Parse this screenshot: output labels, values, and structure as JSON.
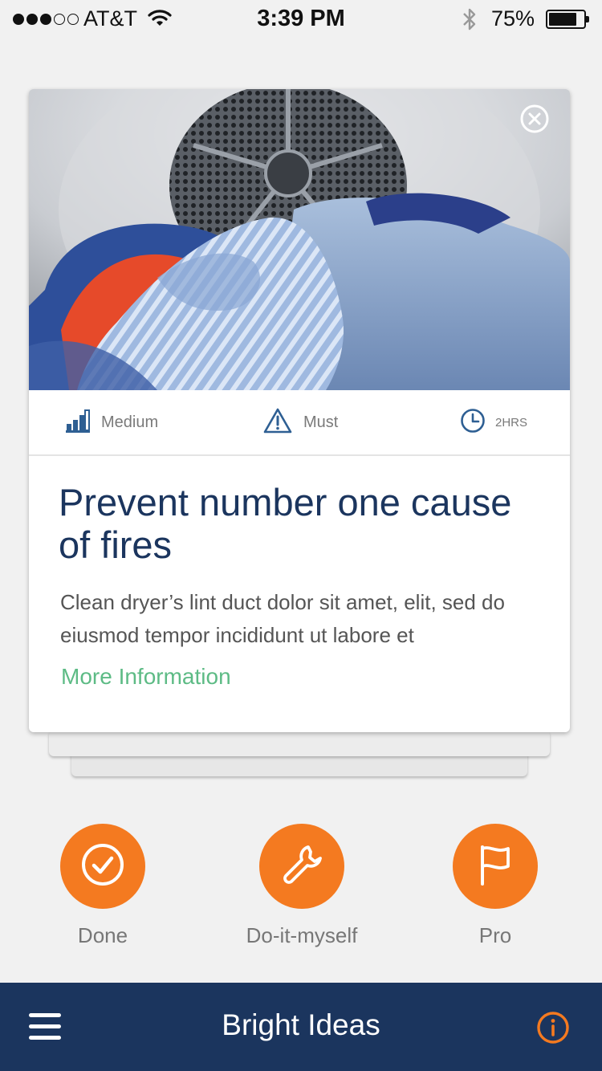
{
  "status_bar": {
    "carrier": "AT&T",
    "time": "3:39 PM",
    "battery_percent": "75%",
    "signal_bars": 3,
    "battery_level": 0.75,
    "icons": [
      "signal-icon",
      "wifi-icon",
      "bluetooth-icon",
      "battery-icon"
    ]
  },
  "card": {
    "image_icon": "dryer-laundry-photo",
    "close_icon": "close-circle-icon",
    "meta": [
      {
        "icon": "bar-chart-icon",
        "label": "Medium"
      },
      {
        "icon": "warning-icon",
        "label": "Must"
      },
      {
        "icon": "clock-icon",
        "label": "2HRS"
      }
    ],
    "title": "Prevent number one cause of fires",
    "description": "Clean dryer’s lint duct dolor sit amet, elit, sed do eiusmod tempor incididunt ut labore et",
    "more_link": "More Information"
  },
  "actions": [
    {
      "icon": "check-circle-icon",
      "label": "Done"
    },
    {
      "icon": "wrench-icon",
      "label": "Do-it-myself"
    },
    {
      "icon": "flag-icon",
      "label": "Pro"
    }
  ],
  "bottom_bar": {
    "menu_icon": "hamburger-menu-icon",
    "title": "Bright Ideas",
    "info_icon": "info-circle-icon"
  },
  "colors": {
    "accent": "#f47a20",
    "navy": "#1b355e",
    "link_green": "#5dbb85",
    "meta_icon_blue": "#2e5f93",
    "background": "#f1f1f1"
  }
}
